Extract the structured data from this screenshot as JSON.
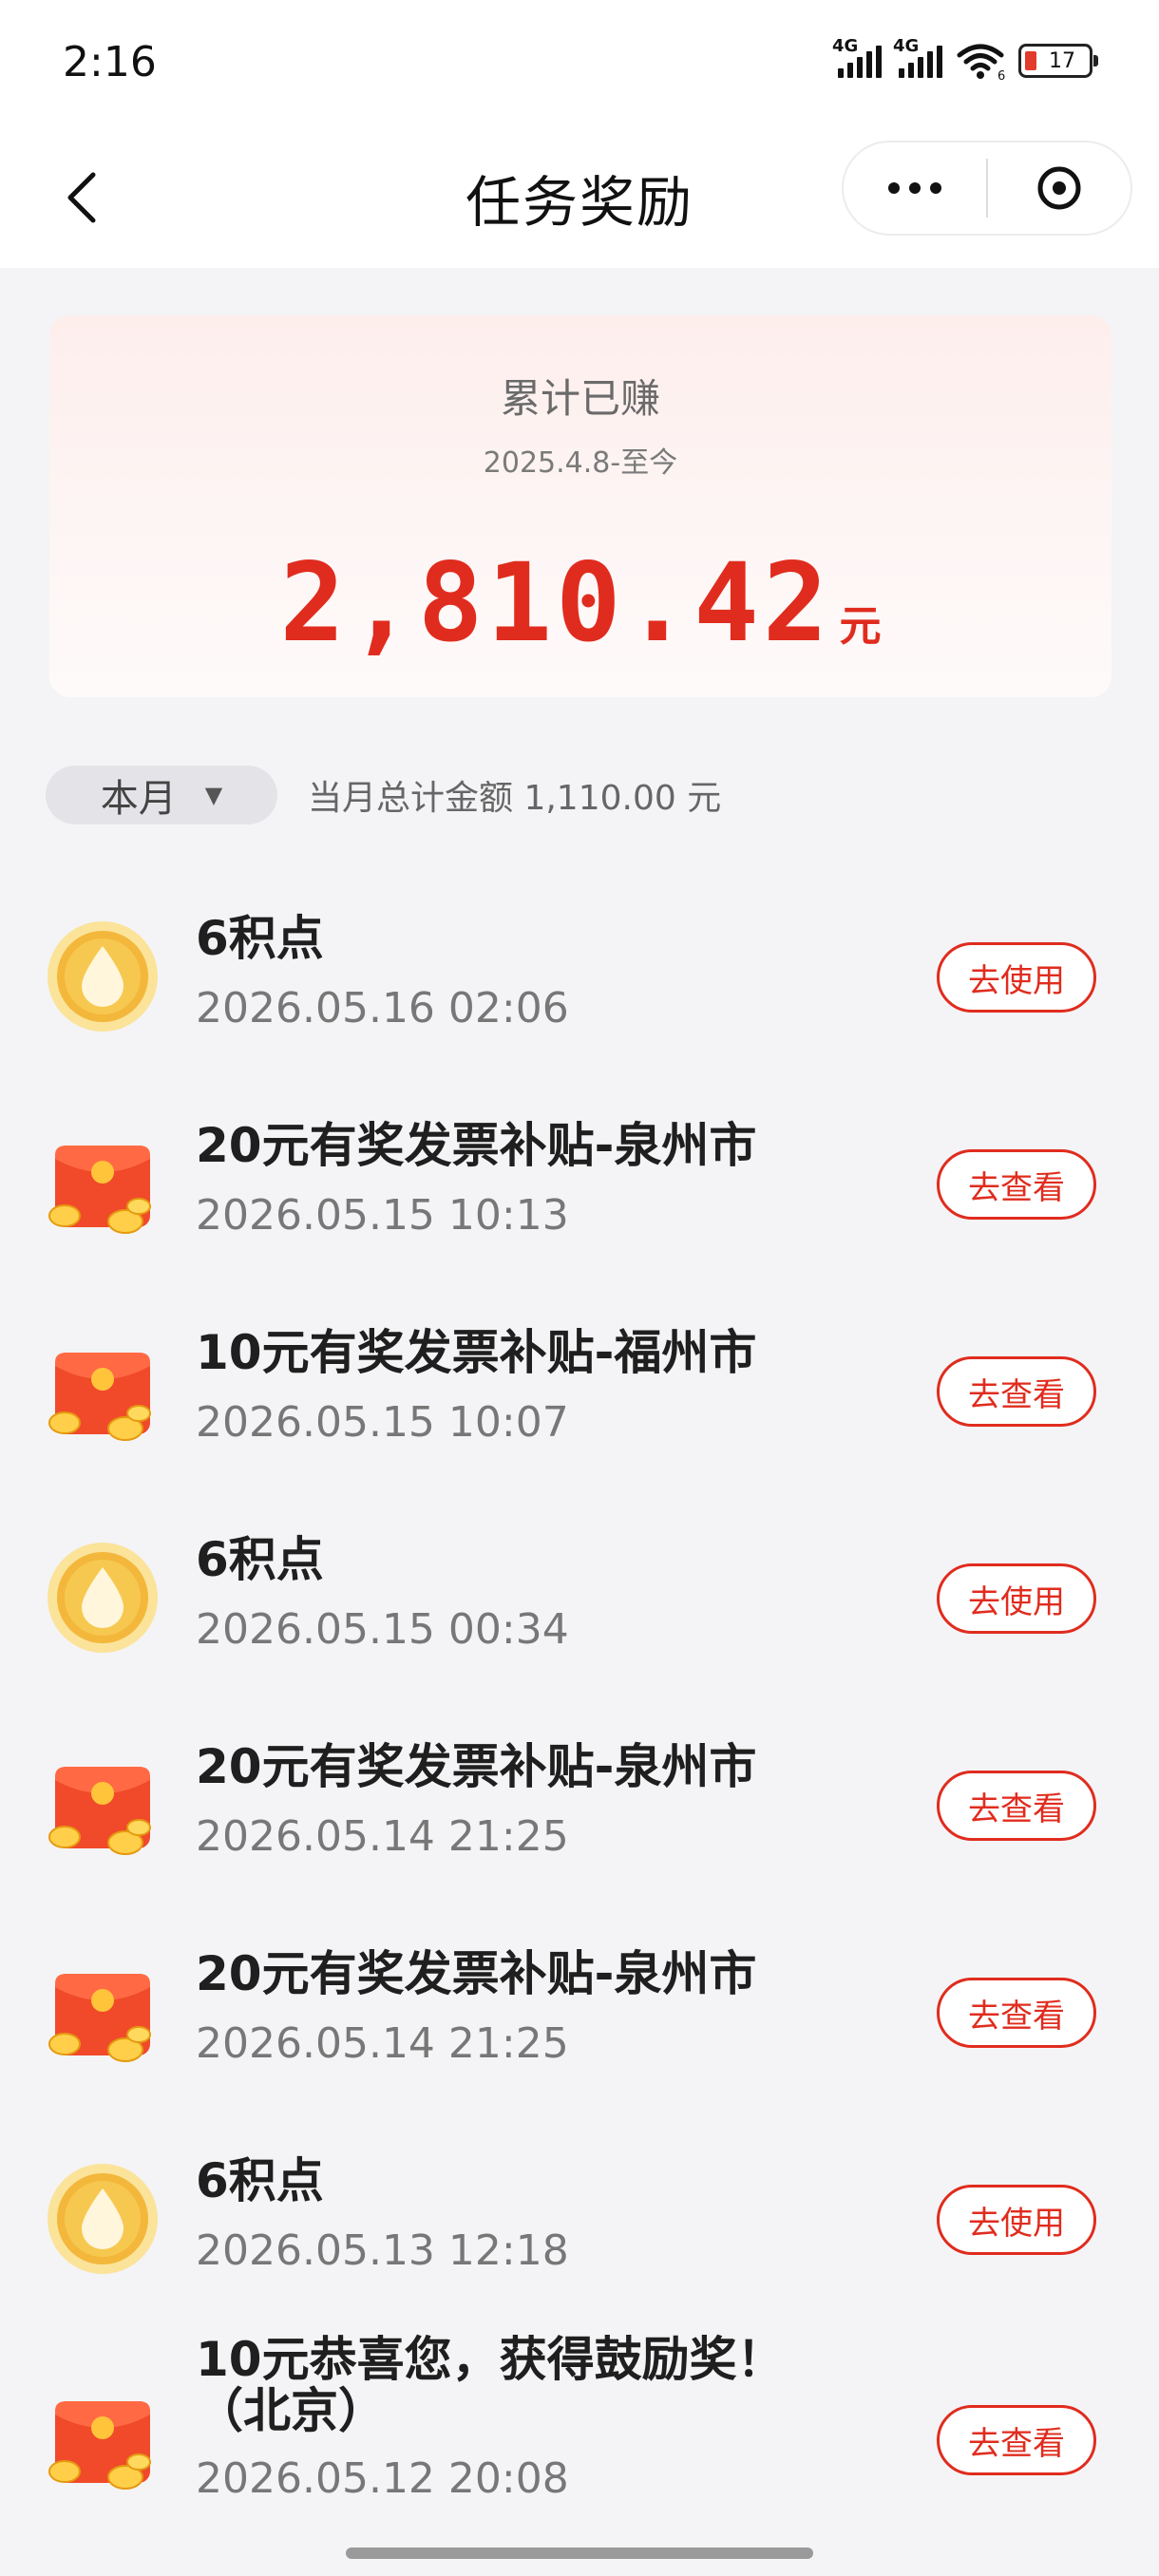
{
  "status_bar": {
    "time": "2:16",
    "network_1": "4G",
    "network_2": "4G",
    "wifi_badge": "6",
    "battery": "17"
  },
  "nav": {
    "title": "任务奖励",
    "back_icon": "chevron-left-icon",
    "more_icon": "more-dots-icon",
    "close_icon": "close-circle-icon"
  },
  "summary": {
    "label": "累计已赚",
    "date_range": "2025.4.8-至今",
    "amount": "2,810.42",
    "unit": "元",
    "accent_color": "#e02c1e"
  },
  "filter": {
    "month_label": "本月",
    "caret": "▼",
    "month_total": "当月总计金额 1,110.00 元"
  },
  "rewards": [
    {
      "icon": "points-drop-icon",
      "title": "6积点",
      "time": "2026.05.16 02:06",
      "action": "去使用"
    },
    {
      "icon": "red-envelope-icon",
      "title": "20元有奖发票补贴-泉州市",
      "time": "2026.05.15 10:13",
      "action": "去查看"
    },
    {
      "icon": "red-envelope-icon",
      "title": "10元有奖发票补贴-福州市",
      "time": "2026.05.15 10:07",
      "action": "去查看"
    },
    {
      "icon": "points-drop-icon",
      "title": "6积点",
      "time": "2026.05.15 00:34",
      "action": "去使用"
    },
    {
      "icon": "red-envelope-icon",
      "title": "20元有奖发票补贴-泉州市",
      "time": "2026.05.14 21:25",
      "action": "去查看"
    },
    {
      "icon": "red-envelope-icon",
      "title": "20元有奖发票补贴-泉州市",
      "time": "2026.05.14 21:25",
      "action": "去查看"
    },
    {
      "icon": "points-drop-icon",
      "title": "6积点",
      "time": "2026.05.13 12:18",
      "action": "去使用"
    },
    {
      "icon": "red-envelope-icon",
      "title": "10元恭喜您，获得鼓励奖！",
      "title_line2": "（北京）",
      "time": "2026.05.12 20:08",
      "action": "去查看"
    }
  ]
}
